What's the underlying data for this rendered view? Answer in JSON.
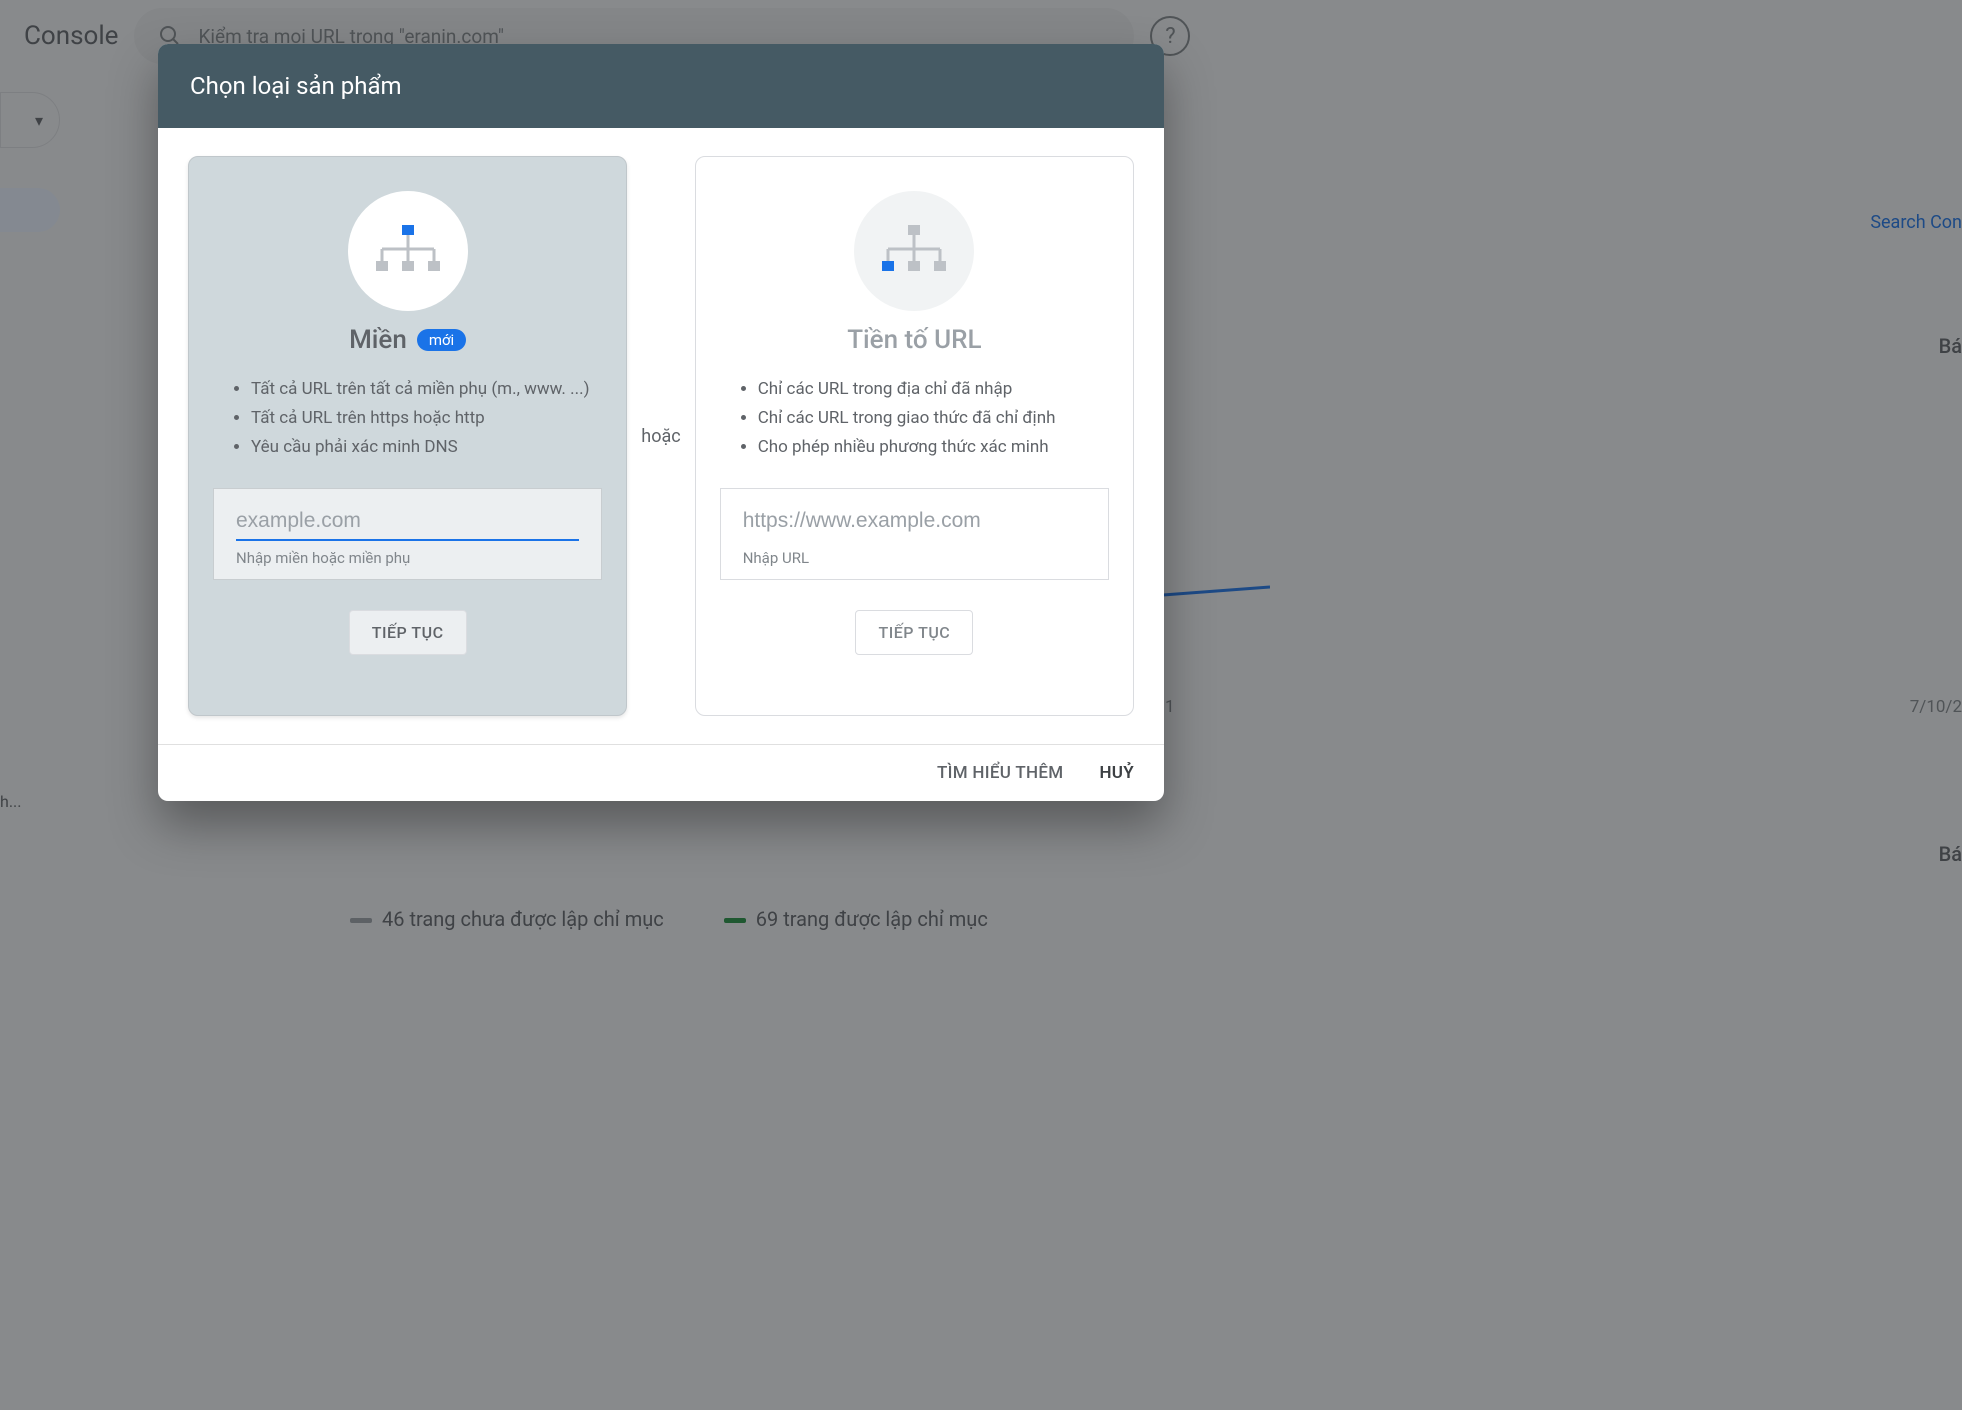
{
  "bg": {
    "brand": "Console",
    "search_placeholder": "Kiểm tra mọi URL trong \"eranin.com\"",
    "help_label": "?",
    "right_link": "Search Con",
    "right_label_1": "Bá",
    "right_label_2": "Bá",
    "tick_1": "1",
    "tick_2": "7/10/2",
    "sidebar_item": "h...",
    "legend_not_indexed": "46 trang chưa được lập chỉ mục",
    "legend_indexed": "69 trang được lập chỉ mục",
    "property_dropdown_glyph": "▾"
  },
  "modal": {
    "title": "Chọn loại sản phẩm",
    "or_label": "hoặc",
    "domain_card": {
      "title": "Miền",
      "badge": "mới",
      "bullets": [
        "Tất cả URL trên tất cả miền phụ (m., www. ...)",
        "Tất cả URL trên https hoặc http",
        "Yêu cầu phải xác minh DNS"
      ],
      "input_placeholder": "example.com",
      "input_hint": "Nhập miền hoặc miền phụ",
      "continue": "TIẾP TỤC"
    },
    "url_card": {
      "title": "Tiền tố URL",
      "bullets": [
        "Chỉ các URL trong địa chỉ đã nhập",
        "Chỉ các URL trong giao thức đã chỉ định",
        "Cho phép nhiều phương thức xác minh"
      ],
      "input_placeholder": "https://www.example.com",
      "input_hint": "Nhập URL",
      "continue": "TIẾP TỤC"
    },
    "footer": {
      "learn_more": "TÌM HIỂU THÊM",
      "cancel": "HUỶ"
    }
  },
  "icons": {
    "search_glyph": "search"
  }
}
